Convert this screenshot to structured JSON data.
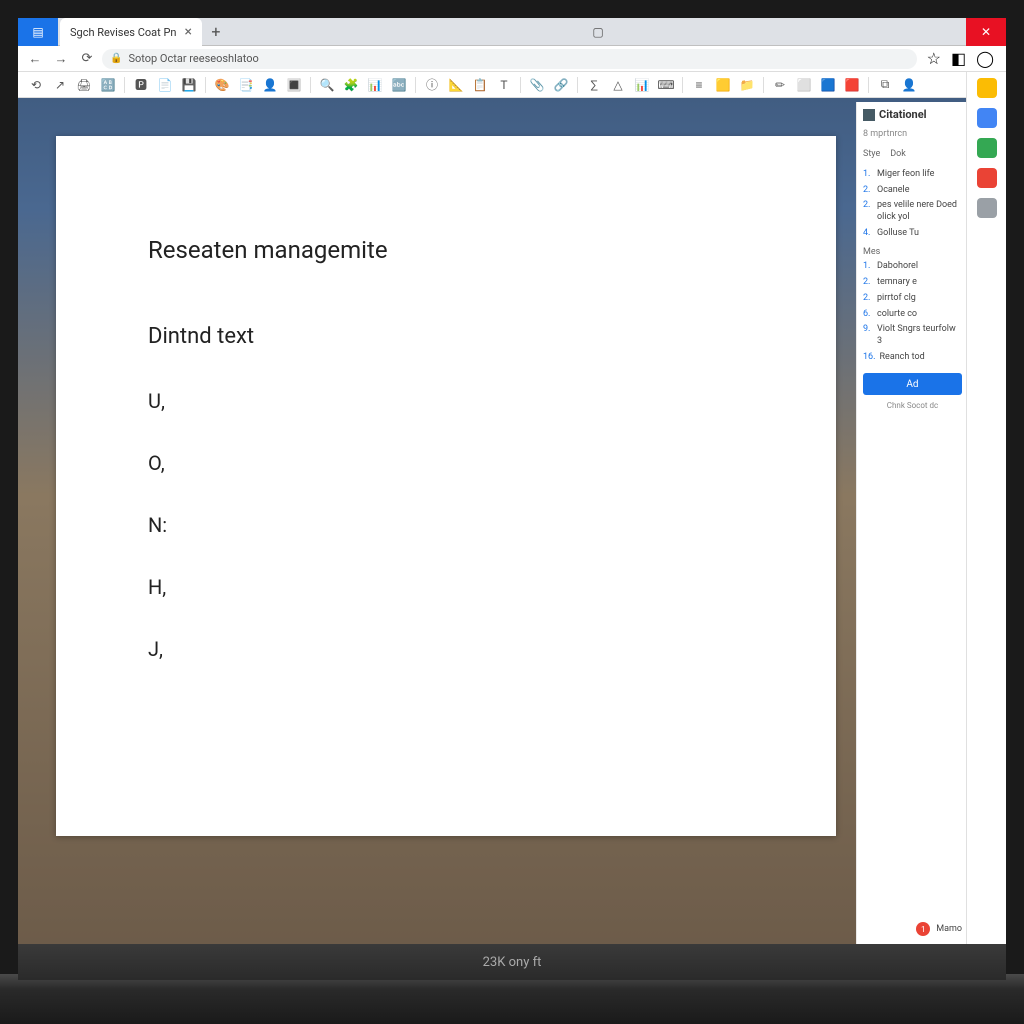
{
  "browser": {
    "tab_title": "Sgch Revises Coat Pn",
    "new_tab": "+",
    "close_tab": "×"
  },
  "addrbar": {
    "back": "←",
    "forward": "→",
    "reload": "⟳",
    "lock": "🔒",
    "url": "Sotop Octar reeseoshlatoo",
    "star": "☆"
  },
  "toolbar": {
    "items": [
      "⟲",
      "↗",
      "🖨",
      "🔠",
      "│",
      "🅿",
      "📄",
      "💾",
      "│",
      "🎨",
      "📑",
      "👤",
      "🔳",
      "│",
      "🔍",
      "🧩",
      "📊",
      "🔤",
      "│",
      "ⓘ",
      "📐",
      "📋",
      "T",
      "│",
      "📎",
      "🔗",
      "│",
      "∑",
      "△",
      "📊",
      "⌨",
      "│",
      "≡",
      "🟨",
      "📁",
      "│",
      "✏",
      "⬜",
      "🟦",
      "🟥",
      "│",
      "⧉",
      "👤"
    ]
  },
  "doc": {
    "title": "Reseaten managemite",
    "subtitle": "Dintnd text",
    "lines": [
      "U,",
      "O,",
      "N:",
      "H,",
      "J,"
    ]
  },
  "panel": {
    "title": "Citationel",
    "sub": "8 mprtnrcn",
    "tab1": "Stye",
    "tab2": "Dok",
    "group1": [
      {
        "n": "1",
        "t": "Miger feon life"
      },
      {
        "n": "2",
        "t": "Ocanele"
      },
      {
        "n": "2",
        "t": "pes velile nere Doed olick yol"
      },
      {
        "n": "4",
        "t": "Golluse Tu"
      }
    ],
    "group2_label": "Mes",
    "group2": [
      {
        "n": "1",
        "t": "Dabohorel"
      },
      {
        "n": "2",
        "t": "temnary e"
      },
      {
        "n": "2",
        "t": "pirrtof clg"
      },
      {
        "n": "6",
        "t": "colurte co"
      },
      {
        "n": "9",
        "t": "Violt Sngrs teurfolw 3"
      },
      {
        "n": "16",
        "t": "Reanch tod"
      }
    ],
    "add": "Ad",
    "footer": "Chnk Socot dc",
    "notif_count": "1",
    "notif_label": "Mamo"
  },
  "status": {
    "text": "23K ony ft"
  }
}
